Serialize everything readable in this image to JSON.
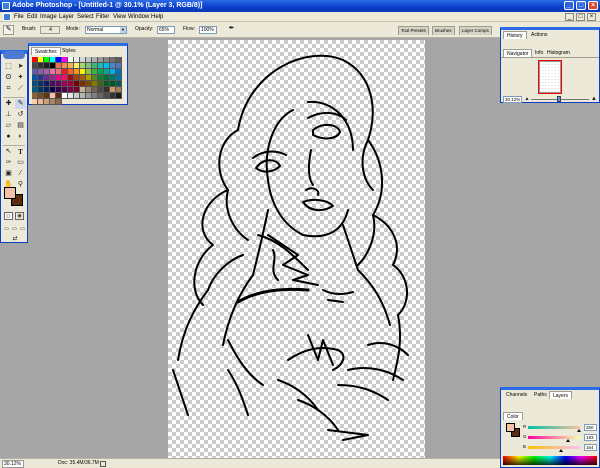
{
  "window": {
    "title": "Adobe Photoshop - [Untitled-1 @ 30.1% (Layer 3, RGB/8)]",
    "min": "_",
    "max": "□",
    "close": "×"
  },
  "menu": [
    "File",
    "Edit",
    "Image",
    "Layer",
    "Select",
    "Filter",
    "View",
    "Window",
    "Help"
  ],
  "options": {
    "brush_label": "Brush:",
    "brush_size": "4",
    "mode_label": "Mode:",
    "mode_value": "Normal",
    "opacity_label": "Opacity:",
    "opacity_value": "65%",
    "flow_label": "Flow:",
    "flow_value": "100%",
    "well_tabs": [
      "Tool Presets",
      "Brushes",
      "Layer Comps"
    ]
  },
  "swatches_panel": {
    "tabs": [
      "Swatches",
      "Styles"
    ],
    "colors": [
      "#ff0000",
      "#ffff00",
      "#00ff00",
      "#00ffff",
      "#0000ff",
      "#ff00ff",
      "#ffffff",
      "#ebebeb",
      "#d6d6d6",
      "#c2c2c2",
      "#adadad",
      "#999999",
      "#858585",
      "#707070",
      "#5c5c5c",
      "#474747",
      "#333333",
      "#1f1f1f",
      "#000000",
      "#f26c4f",
      "#f68e55",
      "#fbaf5c",
      "#fff467",
      "#acd372",
      "#7cc576",
      "#3bb878",
      "#1abbb4",
      "#00bff3",
      "#438ccb",
      "#5574b9",
      "#605ca8",
      "#855fa8",
      "#a763a8",
      "#f06ea9",
      "#f26d7d",
      "#ed1c24",
      "#f26522",
      "#f7941d",
      "#fff200",
      "#8dc73f",
      "#39b54a",
      "#00a651",
      "#00a99d",
      "#00aeef",
      "#0072bc",
      "#0054a6",
      "#2e3192",
      "#662d91",
      "#92278f",
      "#ec008c",
      "#ed145b",
      "#9e0b0f",
      "#a0410d",
      "#a36209",
      "#aba000",
      "#598527",
      "#1a7b30",
      "#007236",
      "#00746b",
      "#0076a3",
      "#004b80",
      "#003471",
      "#1b1464",
      "#440e62",
      "#630460",
      "#9e005d",
      "#9e0039",
      "#790000",
      "#7b2e00",
      "#7d4900",
      "#827b00",
      "#406618",
      "#005e20",
      "#005826",
      "#005952",
      "#005b7f",
      "#003663",
      "#002157",
      "#0d004c",
      "#32004b",
      "#4b0049",
      "#7b0046",
      "#7a0026",
      "#c7b299",
      "#998675",
      "#736357",
      "#534741",
      "#37302d",
      "#c69c6d",
      "#a67c52",
      "#8c6239",
      "#754c24",
      "#603913",
      "#f5c1aa",
      "#5c2c12",
      "#ffffff",
      "#e6e6e6",
      "#cccccc",
      "#b3b3b3",
      "#999999",
      "#808080",
      "#666666",
      "#4d4d4d",
      "#333333",
      "#1a1a1a",
      "#ffccaa",
      "#e8b894",
      "#caa07a",
      "#ab8560",
      "#8c6a46"
    ]
  },
  "navigator_panel": {
    "tabs_top": [
      "History",
      "Actions"
    ],
    "tabs": [
      "Navigator",
      "Info",
      "Histogram"
    ],
    "zoom": "30.12%"
  },
  "color_panel": {
    "tabs_top": [
      "Channels",
      "Paths",
      "Layers"
    ],
    "tab": "Color",
    "channels": [
      {
        "label": "R",
        "value": "250",
        "level": 0.98
      },
      {
        "label": "G",
        "value": "193",
        "level": 0.76
      },
      {
        "label": "B",
        "value": "164",
        "level": 0.64
      }
    ]
  },
  "status": {
    "zoom": "30.12%",
    "doc": "Doc: 35.4M/36.7M"
  },
  "colors": {
    "foreground": "#f5c1aa",
    "background": "#5c2c12"
  },
  "tools": [
    "marquee-icon",
    "move-icon",
    "lasso-icon",
    "magic-wand-icon",
    "crop-icon",
    "slice-icon",
    "healing-icon",
    "brush-icon",
    "stamp-icon",
    "history-brush-icon",
    "eraser-icon",
    "gradient-icon",
    "blur-icon",
    "dodge-icon",
    "path-select-icon",
    "type-icon",
    "pen-icon",
    "shape-icon",
    "notes-icon",
    "eyedropper-icon",
    "hand-icon",
    "zoom-icon"
  ]
}
